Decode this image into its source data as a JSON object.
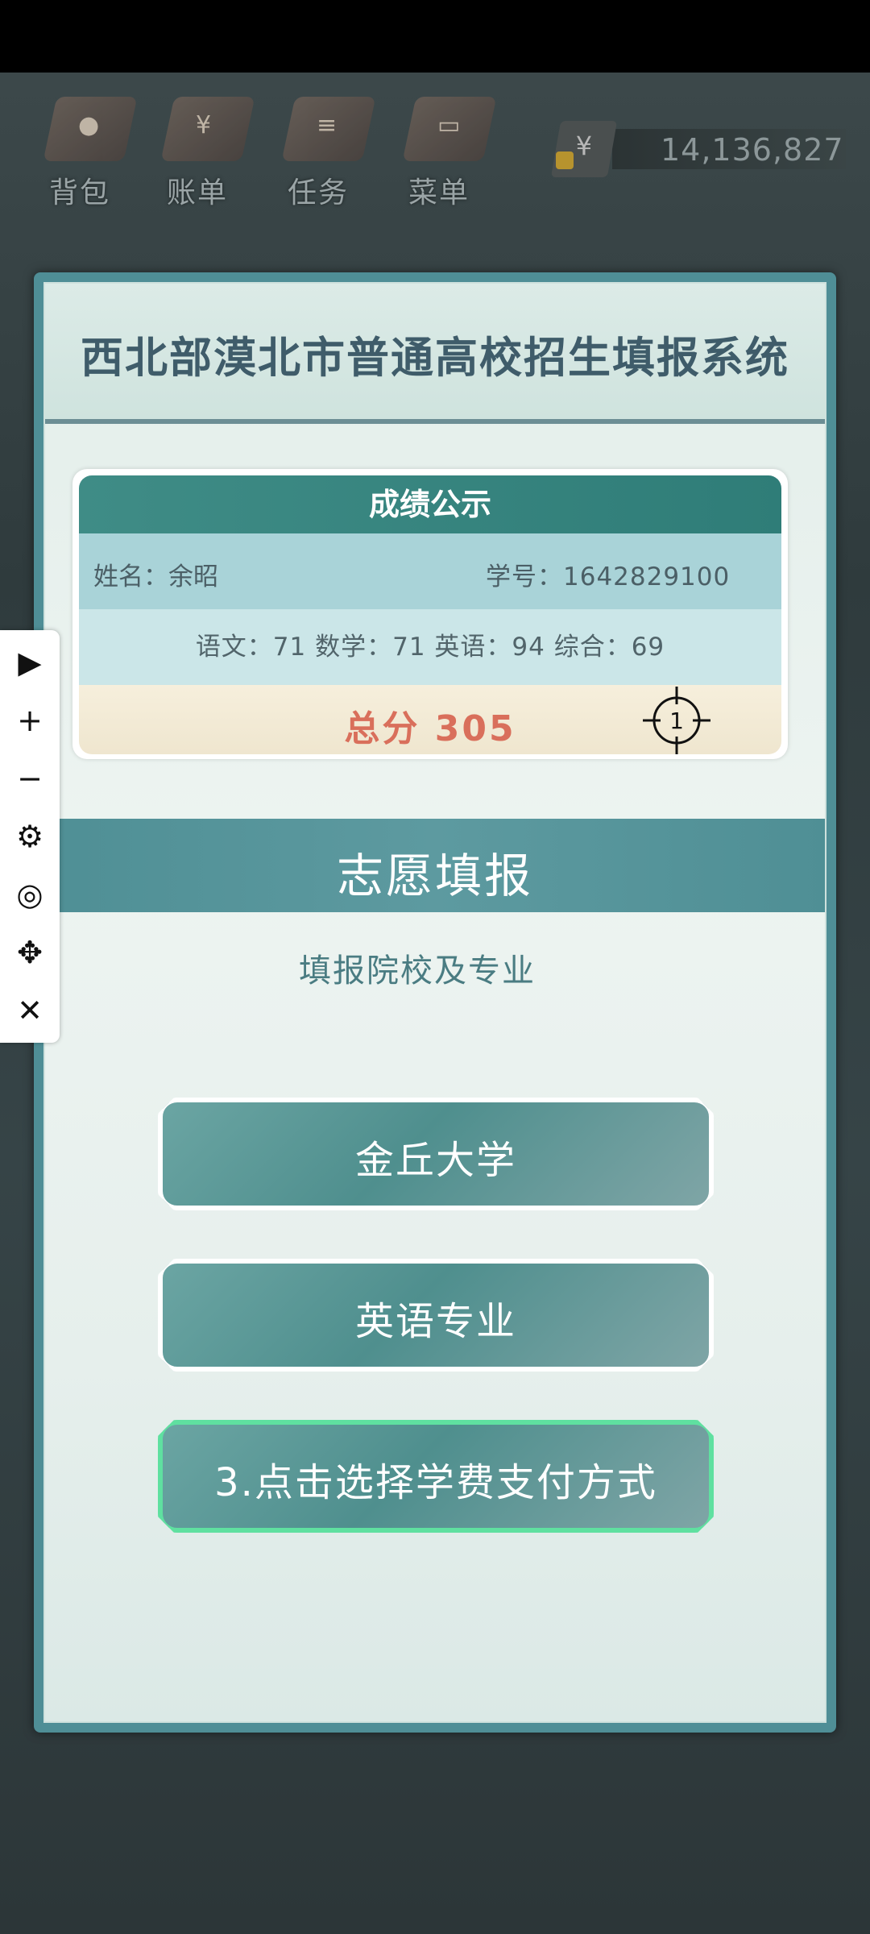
{
  "topbar": {
    "items": [
      {
        "label": "背包",
        "glyph": "●"
      },
      {
        "label": "账单",
        "glyph": "¥"
      },
      {
        "label": "任务",
        "glyph": "≡"
      },
      {
        "label": "菜单",
        "glyph": "▭"
      }
    ],
    "currency_symbol": "¥",
    "money": "14,136,827"
  },
  "panel": {
    "title": "西北部漠北市普通高校招生填报系统",
    "score_card": {
      "header": "成绩公示",
      "name": "姓名：余昭",
      "student_id": "学号：1642829100",
      "subjects": "语文：71  数学：71  英语：94  综合：69",
      "total": "总分 305",
      "target_marker_number": "1"
    },
    "wish_section": {
      "title": "志愿填报",
      "subtitle": "填报院校及专业"
    },
    "choices": [
      {
        "label": "金丘大学"
      },
      {
        "label": "英语专业"
      },
      {
        "label": "3.点击选择学费支付方式"
      }
    ]
  },
  "side_toolbar": {
    "items": [
      {
        "name": "play-icon",
        "glyph": "▶"
      },
      {
        "name": "zoom-in-icon",
        "glyph": "+"
      },
      {
        "name": "zoom-out-icon",
        "glyph": "−"
      },
      {
        "name": "gear-icon",
        "glyph": "⚙"
      },
      {
        "name": "eye-off-icon",
        "glyph": "◎"
      },
      {
        "name": "move-icon",
        "glyph": "✥"
      },
      {
        "name": "close-icon",
        "glyph": "✕"
      }
    ]
  },
  "colors": {
    "panel_border": "#4f8e96",
    "title_text": "#3f5c6a",
    "total_text": "#d96f5b",
    "active_choice_border": "#5fe0a0"
  }
}
